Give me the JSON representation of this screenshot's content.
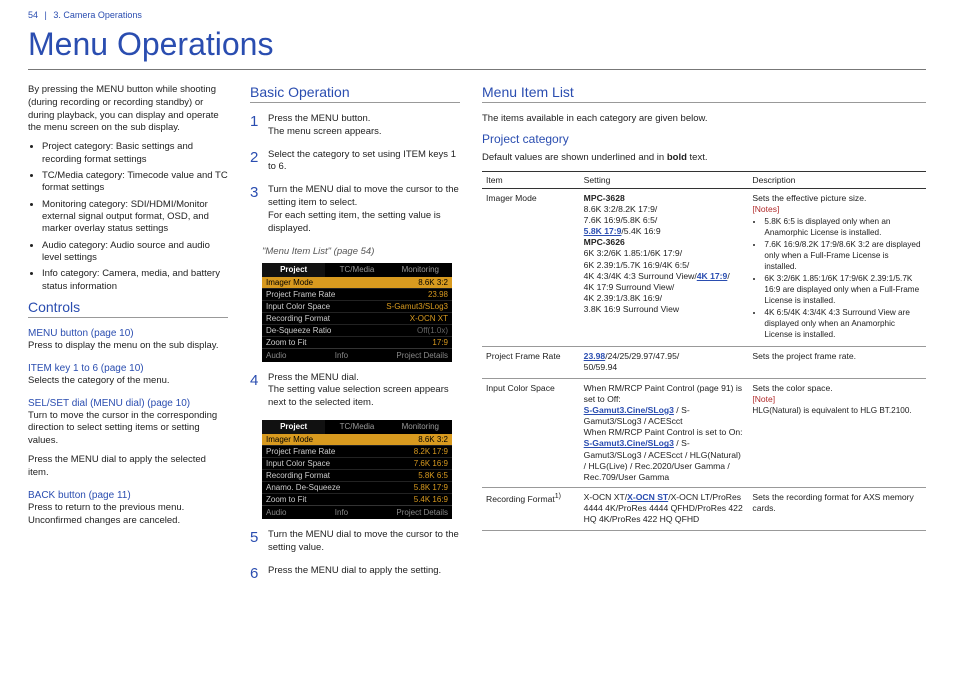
{
  "header": {
    "pageNum": "54",
    "chapter": "3. Camera Operations"
  },
  "title": "Menu Operations",
  "intro": {
    "p1": "By pressing the MENU button while shooting (during recording or recording standby) or during playback, you can display and operate the menu screen on the sub display.",
    "bullets": [
      "Project category: Basic settings and recording format settings",
      "TC/Media category: Timecode value and TC format settings",
      "Monitoring category: SDI/HDMI/Monitor external signal output format, OSD, and marker overlay status settings",
      "Audio category: Audio source and audio level settings",
      "Info category: Camera, media, and battery status information"
    ]
  },
  "controls": {
    "heading": "Controls",
    "items": [
      {
        "h": "MENU button (page 10)",
        "p": "Press to display the menu on the sub display."
      },
      {
        "h": "ITEM key 1 to 6 (page 10)",
        "p": "Selects the category of the menu."
      },
      {
        "h": "SEL/SET dial (MENU dial) (page 10)",
        "p": "Turn to move the cursor in the corresponding direction to select setting items or setting values.",
        "p2": "Press the MENU dial to apply the selected item."
      },
      {
        "h": "BACK button (page 11)",
        "p": "Press to return to the previous menu. Unconfirmed changes are canceled."
      }
    ]
  },
  "basic": {
    "heading": "Basic Operation",
    "steps": [
      {
        "n": "1",
        "t1": "Press the MENU button.",
        "t2": "The menu screen appears."
      },
      {
        "n": "2",
        "t1": "Select the category to set using ITEM keys 1 to 6."
      },
      {
        "n": "3",
        "t1": "Turn the MENU dial to move the cursor to the setting item to select.",
        "t2": "For each setting item, the setting value is displayed."
      },
      {
        "n": "4",
        "t1": "Press the MENU dial.",
        "t2": "The setting value selection screen appears next to the selected item."
      },
      {
        "n": "5",
        "t1": "Turn the MENU dial to move the cursor to the setting value."
      },
      {
        "n": "6",
        "t1": "Press the MENU dial to apply the setting."
      }
    ],
    "ref": "\"Menu Item List\" (page 54)"
  },
  "cam1": {
    "tabs": [
      "Project",
      "TC/Media",
      "Monitoring"
    ],
    "rows": [
      [
        "Imager Mode",
        "8.6K 3:2",
        true
      ],
      [
        "Project Frame Rate",
        "23.98"
      ],
      [
        "Input Color Space",
        "S-Gamut3/SLog3"
      ],
      [
        "Recording Format",
        "X-OCN XT"
      ],
      [
        "De-Squeeze Ratio",
        "Off(1.0x)"
      ],
      [
        "Zoom to Fit",
        "17:9"
      ]
    ],
    "foot": [
      "Audio",
      "Info",
      "Project Details"
    ]
  },
  "cam2": {
    "tabs": [
      "Project",
      "TC/Media",
      "Monitoring"
    ],
    "rows": [
      [
        "Imager Mode",
        "8.6K 3:2",
        true
      ],
      [
        "Project Frame Rate",
        "8.2K 17:9"
      ],
      [
        "Input Color Space",
        "7.6K 16:9"
      ],
      [
        "Recording Format",
        "5.8K 6:5"
      ],
      [
        "Anamo. De-Squeeze",
        "5.8K 17:9"
      ],
      [
        "Zoom to Fit",
        "5.4K 16:9"
      ]
    ],
    "foot": [
      "Audio",
      "Info",
      "Project Details"
    ]
  },
  "menuList": {
    "heading": "Menu Item List",
    "intro": "The items available in each category are given below.",
    "project": {
      "heading": "Project category",
      "default_note": "Default values are shown underlined and in bold text.",
      "th": [
        "Item",
        "Setting",
        "Description"
      ],
      "rows": [
        {
          "item": "Imager Mode",
          "setting_html": "<b>MPC-3628</b><br>8.6K 3:2/8.2K 17:9/<br>7.6K 16:9/5.8K 6:5/<br><span class='blue'><b><u>5.8K 17:9</u></b></span>/5.4K 16:9<br><b>MPC-3626</b><br>6K 3:2/6K 1.85:1/6K 17:9/<br>6K 2.39:1/5.7K 16:9/4K 6:5/<br>4K 4:3/4K 4:3 Surround View/<span class='blue'><b><u>4K 17:9</u></b></span>/<br>4K 17:9 Surround View/<br>4K 2.39:1/3.8K 16:9/<br>3.8K 16:9 Surround View",
          "desc_html": "Sets the effective picture size.<br><span class='note'>[Notes]</span><ul class='notelist'><li>5.8K 6:5 is displayed only when an Anamorphic License is installed.</li><li>7.6K 16:9/8.2K 17:9/8.6K 3:2 are displayed only when a Full-Frame License is installed.</li><li>6K 3:2/6K 1.85:1/6K 17:9/6K 2.39:1/5.7K 16:9 are displayed only when a Full-Frame License is installed.</li><li>4K 6:5/4K 4:3/4K 4:3 Surround View are displayed only when an Anamorphic License is installed.</li></ul>"
        },
        {
          "item": "Project Frame Rate",
          "setting_html": "<span class='blue'><b><u>23.98</u></b></span>/24/25/29.97/47.95/<br>50/59.94",
          "desc_html": "Sets the project frame rate."
        },
        {
          "item": "Input Color Space",
          "setting_html": "When RM/RCP Paint Control (page 91) is set to Off:<br><span class='blue'><b><u>S-Gamut3.Cine/SLog3</u></b></span> / S-Gamut3/SLog3 / ACEScct<br>When RM/RCP Paint Control is set to On:<br><span class='blue'><b><u>S-Gamut3.Cine/SLog3</u></b></span> / S-Gamut3/SLog3 / ACEScct / HLG(Natural) / HLG(Live) / Rec.2020/User Gamma / Rec.709/User Gamma",
          "desc_html": "Sets the color space.<br><span class='note'>[Note]</span><br><span style='font-size:8.2px'>HLG(Natural) is equivalent to HLG BT.2100.</span>"
        },
        {
          "item_html": "Recording Format<span class='sup'>1)</span>",
          "setting_html": "X-OCN XT/<span class='blue'><b><u>X-OCN ST</u></b></span>/X-OCN LT/ProRes 4444 4K/ProRes 4444 QFHD/ProRes 422 HQ 4K/ProRes 422 HQ QFHD",
          "desc_html": "Sets the recording format for AXS memory cards."
        }
      ]
    }
  }
}
